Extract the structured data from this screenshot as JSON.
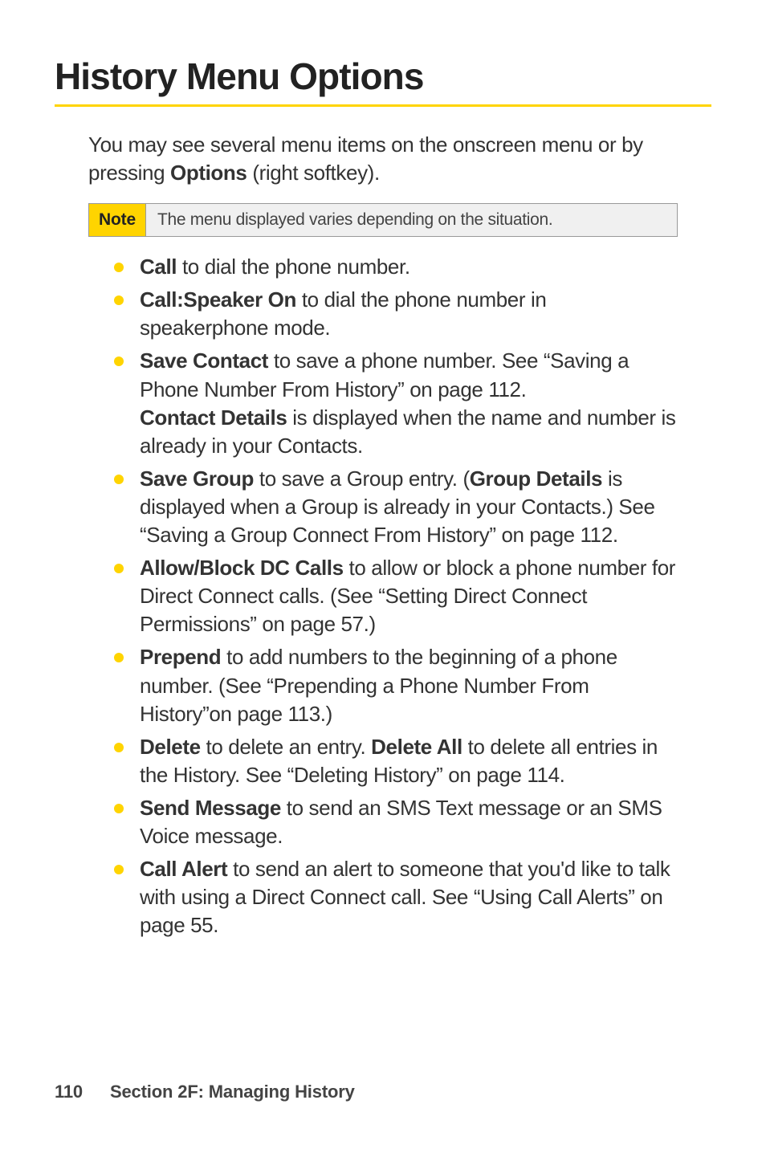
{
  "page": {
    "title": "History Menu Options",
    "intro_pre": "You may see several menu items on the onscreen menu or by pressing ",
    "intro_bold": "Options",
    "intro_post": " (right softkey)."
  },
  "note": {
    "label": "Note",
    "text": "The menu displayed varies depending on the situation."
  },
  "bullets": {
    "b1_bold": "Call",
    "b1_text": " to dial the phone number.",
    "b2_bold": "Call:Speaker On",
    "b2_text": " to dial the phone number in speakerphone mode.",
    "b3_bold1": "Save Contact",
    "b3_text1": " to save a phone number. See “Saving a Phone Number From History” on page 112.",
    "b3_bold2": "Contact Details",
    "b3_text2": " is displayed when the name and number is already in your Contacts.",
    "b4_bold1": "Save Group",
    "b4_text1": " to save a Group entry. (",
    "b4_bold2": "Group Details",
    "b4_text2": " is displayed when a Group is already in your Contacts.) See “Saving a Group Connect From History” on page 112.",
    "b5_bold": "Allow/Block DC Calls",
    "b5_text": " to allow or block a phone number for Direct Connect calls. (See “Setting Direct Connect Permissions” on page 57.)",
    "b6_bold": "Prepend",
    "b6_text": " to add numbers to the beginning of a phone number. (See “Prepending a Phone Number From History”on page 113.)",
    "b7_bold1": "Delete",
    "b7_text1": " to delete an entry. ",
    "b7_bold2": "Delete All",
    "b7_text2": " to delete all entries in the History. See “Deleting History” on page 114.",
    "b8_bold": "Send Message",
    "b8_text": " to send an SMS Text message or an SMS Voice message.",
    "b9_bold": "Call Alert",
    "b9_text": " to send an alert to someone that you'd like to talk with using a Direct Connect call. See “Using Call Alerts” on page 55."
  },
  "footer": {
    "page_number": "110",
    "section": "Section 2F: Managing History"
  }
}
